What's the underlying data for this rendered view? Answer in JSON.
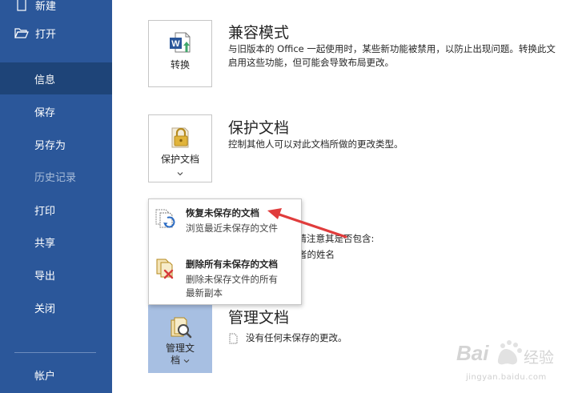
{
  "sidebar": {
    "new_label": "新建",
    "open_label": "打开",
    "info_label": "信息",
    "save_label": "保存",
    "save_as_label": "另存为",
    "history_label": "历史记录",
    "print_label": "打印",
    "share_label": "共享",
    "export_label": "导出",
    "close_label": "关闭",
    "account_label": "帐户"
  },
  "compat": {
    "title": "兼容模式",
    "button_label": "转换",
    "desc_line1": "与旧版本的 Office 一起使用时，某些新功能被禁用，以防止出现问题。转换此文",
    "desc_line2": "启用这些功能，但可能会导致布局更改。"
  },
  "protect": {
    "title": "保护文档",
    "button_label": "保护文档",
    "desc": "控制其他人可以对此文档所做的更改类型。"
  },
  "inspect_partial": {
    "line1": "，请注意其是否包含:",
    "line2": "者的姓名"
  },
  "dropdown": {
    "recover_title": "恢复未保存的文档",
    "recover_desc": "浏览最近未保存的文件",
    "delete_title": "删除所有未保存的文档",
    "delete_desc_line1": "删除未保存文件的所有",
    "delete_desc_line2": "最新副本"
  },
  "manage": {
    "title": "管理文档",
    "button_label_line1": "管理文",
    "button_label_line2": "档",
    "desc": "没有任何未保存的更改。"
  },
  "watermark": {
    "brand": "Bai",
    "brand2": "经验",
    "url": "jingyan.baidu.com"
  },
  "colors": {
    "sidebar": "#2b579a",
    "sidebar_active": "#1e4478",
    "selected_button": "#a7bfe2",
    "arrow": "#e03c3c"
  }
}
